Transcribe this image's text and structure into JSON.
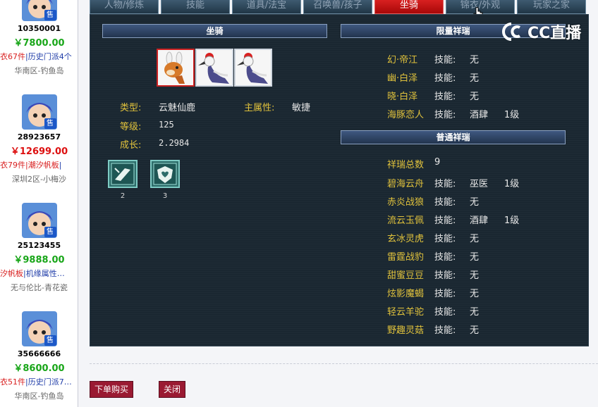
{
  "listings": [
    {
      "id": "10350001",
      "price": "￥7800.00",
      "price_color": "green",
      "tag1": "衣67件",
      "tag2": "|历史门派4个",
      "server": "华南区-钓鱼岛",
      "badge": "售"
    },
    {
      "id": "28923657",
      "price": "￥12699.00",
      "price_color": "red",
      "tag1": "衣79件",
      "tag2": "|潮汐帆板",
      "tag3": "|",
      "server": "深圳2区-小梅沙",
      "badge": "售"
    },
    {
      "id": "25123455",
      "price": "￥9888.00",
      "price_color": "green",
      "tag1": "汐帆板",
      "tag2": "|机缘属性…",
      "server": "无与伦比-青花瓷",
      "badge": "售"
    },
    {
      "id": "35666666",
      "price": "￥8600.00",
      "price_color": "green",
      "tag1": "衣51件",
      "tag2": "|历史门派7…",
      "server": "华南区-钓鱼岛",
      "badge": "售"
    }
  ],
  "tabs": [
    "人物/修炼",
    "技能",
    "道具/法宝",
    "召唤兽/孩子",
    "坐骑",
    "锦衣/外观",
    "玩家之家"
  ],
  "active_tab": "坐骑",
  "mount_section": {
    "title": "坐骑",
    "type_label": "类型:",
    "type_value": "云魅仙鹿",
    "attr_label": "主属性:",
    "attr_value": "敏捷",
    "level_label": "等级:",
    "level_value": "125",
    "growth_label": "成长:",
    "growth_value": "2.2984",
    "skill_counts": [
      "2",
      "3"
    ]
  },
  "limited_section": {
    "title": "限量祥瑞",
    "items": [
      {
        "name": "幻·帝江",
        "skill_label": "技能:",
        "skill": "无",
        "level": ""
      },
      {
        "name": "幽·白泽",
        "skill_label": "技能:",
        "skill": "无",
        "level": ""
      },
      {
        "name": "晓·白泽",
        "skill_label": "技能:",
        "skill": "无",
        "level": ""
      },
      {
        "name": "海豚恋人",
        "skill_label": "技能:",
        "skill": "酒肆",
        "level": "1级"
      }
    ]
  },
  "normal_section": {
    "title": "普通祥瑞",
    "total_label": "祥瑞总数",
    "total_value": "9",
    "items": [
      {
        "name": "碧海云舟",
        "skill_label": "技能:",
        "skill": "巫医",
        "level": "1级"
      },
      {
        "name": "赤炎战狼",
        "skill_label": "技能:",
        "skill": "无",
        "level": ""
      },
      {
        "name": "流云玉佩",
        "skill_label": "技能:",
        "skill": "酒肆",
        "level": "1级"
      },
      {
        "name": "玄冰灵虎",
        "skill_label": "技能:",
        "skill": "无",
        "level": ""
      },
      {
        "name": "雷霆战豹",
        "skill_label": "技能:",
        "skill": "无",
        "level": ""
      },
      {
        "name": "甜蜜豆豆",
        "skill_label": "技能:",
        "skill": "无",
        "level": ""
      },
      {
        "name": "炫影魔蝎",
        "skill_label": "技能:",
        "skill": "无",
        "level": ""
      },
      {
        "name": "轻云羊驼",
        "skill_label": "技能:",
        "skill": "无",
        "level": ""
      },
      {
        "name": "野趣灵菇",
        "skill_label": "技能:",
        "skill": "无",
        "level": ""
      }
    ]
  },
  "watermark": {
    "text": "CC直播",
    "icon": "cc-logo-icon"
  },
  "buttons": {
    "order": "下单购买",
    "close": "关闭"
  },
  "colors": {
    "panel_bg": "#1a2731",
    "label_yellow": "#e0c23c",
    "active_tab": "#c81414",
    "price_green": "#19a619",
    "price_red": "#dd1010",
    "button": "#9a1a32"
  }
}
